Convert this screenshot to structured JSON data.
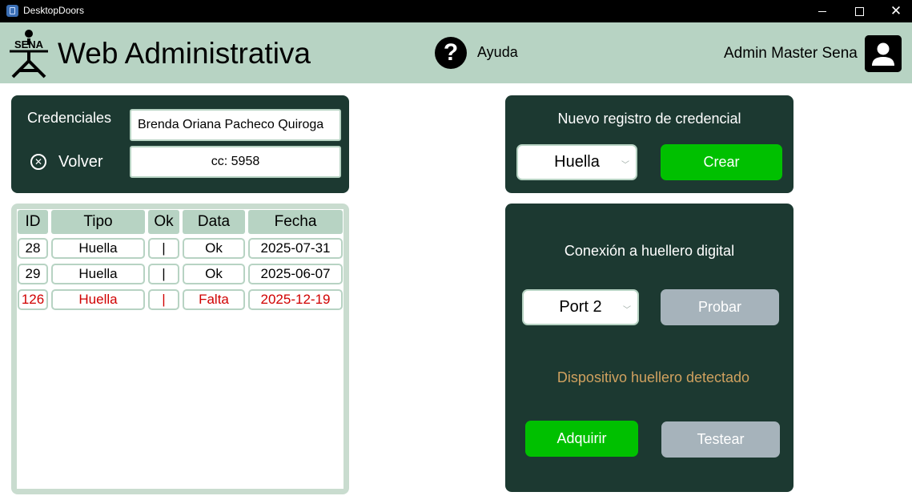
{
  "window": {
    "title": "DesktopDoors"
  },
  "header": {
    "logo_text": "SENA",
    "title": "Web Administrativa",
    "help_label": "Ayuda",
    "user_name": "Admin Master Sena"
  },
  "credentials": {
    "label": "Credenciales",
    "back_label": "Volver",
    "name_value": "Brenda Oriana Pacheco Quiroga",
    "cc_value": "cc: 5958"
  },
  "table": {
    "columns": [
      "ID",
      "Tipo",
      "Ok",
      "Data",
      "Fecha"
    ],
    "rows": [
      {
        "id": "28",
        "tipo": "Huella",
        "ok": "|",
        "data": "Ok",
        "fecha": "2025-07-31",
        "status": "normal"
      },
      {
        "id": "29",
        "tipo": "Huella",
        "ok": "|",
        "data": "Ok",
        "fecha": "2025-06-07",
        "status": "normal"
      },
      {
        "id": "126",
        "tipo": "Huella",
        "ok": "|",
        "data": "Falta",
        "fecha": "2025-12-19",
        "status": "missing"
      }
    ]
  },
  "new_credential": {
    "title": "Nuevo registro de credencial",
    "type_selected": "Huella",
    "create_label": "Crear"
  },
  "connection": {
    "title": "Conexión a huellero digital",
    "port_selected": "Port 2",
    "probe_label": "Probar",
    "status_text": "Dispositivo huellero detectado",
    "acquire_label": "Adquirir",
    "test_label": "Testear"
  },
  "colors": {
    "header_bg": "#b7d3c3",
    "panel_bg": "#1c3931",
    "primary_button": "#00c000",
    "disabled_button": "#a6b3bb",
    "status_text": "#d0a15f",
    "missing_row": "#d00000"
  }
}
